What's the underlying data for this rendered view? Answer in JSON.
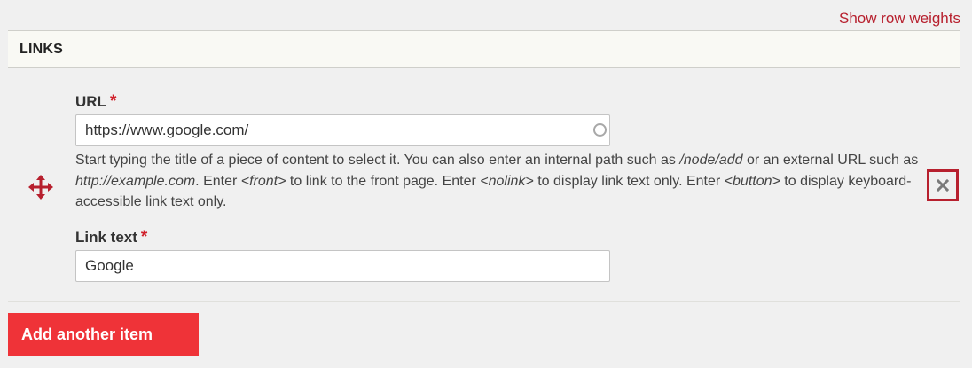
{
  "header": {
    "row_weights_link": "Show row weights",
    "table_title": "LINKS"
  },
  "row": {
    "url": {
      "label": "URL",
      "required_marker": "*",
      "value": "https://www.google.com/"
    },
    "description": {
      "part1": "Start typing the title of a piece of content to select it. You can also enter an internal path such as ",
      "em1": "/node/add",
      "part2": " or an external URL such as ",
      "em2": "http://example.com",
      "part3": ". Enter ",
      "em3": "<front>",
      "part4": " to link to the front page. Enter ",
      "em4": "<nolink>",
      "part5": " to display link text only. Enter ",
      "em5": "<button>",
      "part6": " to display keyboard-accessible link text only."
    },
    "link_text": {
      "label": "Link text",
      "required_marker": "*",
      "value": "Google"
    },
    "icons": {
      "drag": "move-arrows-icon",
      "remove": "close-icon",
      "autocomplete": "autocomplete-throbber-icon"
    }
  },
  "footer": {
    "add_button_label": "Add another item"
  },
  "colors": {
    "accent": "#b7202e",
    "button_bg": "#ef3338",
    "required": "#d0202a",
    "page_bg": "#f0f0f0",
    "header_bg": "#f9f9f4"
  }
}
